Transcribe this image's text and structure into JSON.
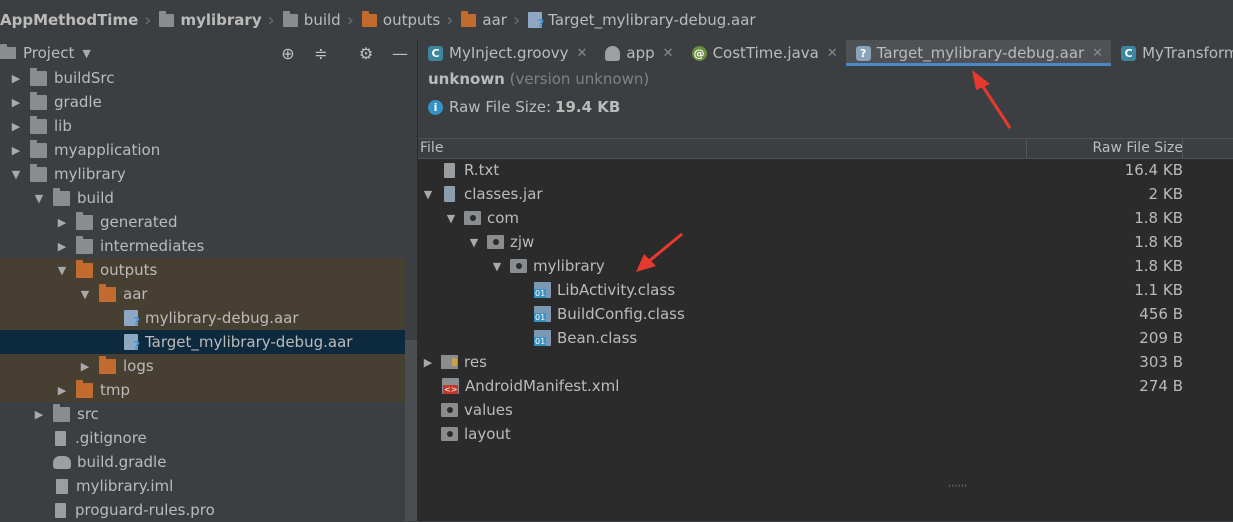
{
  "breadcrumbs": [
    "AppMethodTime",
    "mylibrary",
    "build",
    "outputs",
    "aar",
    "Target_mylibrary-debug.aar"
  ],
  "project_panel": {
    "title": "Project",
    "tree": [
      {
        "label": "buildSrc",
        "depth": 0,
        "expanded": false,
        "icon": "module-folder-icon"
      },
      {
        "label": "gradle",
        "depth": 0,
        "expanded": false,
        "icon": "folder-icon"
      },
      {
        "label": "lib",
        "depth": 0,
        "expanded": false,
        "icon": "folder-icon"
      },
      {
        "label": "myapplication",
        "depth": 0,
        "expanded": false,
        "icon": "folder-icon"
      },
      {
        "label": "mylibrary",
        "depth": 0,
        "expanded": true,
        "icon": "module-folder-icon"
      },
      {
        "label": "build",
        "depth": 1,
        "expanded": true,
        "icon": "folder-icon"
      },
      {
        "label": "generated",
        "depth": 2,
        "expanded": false,
        "icon": "folder-icon"
      },
      {
        "label": "intermediates",
        "depth": 2,
        "expanded": false,
        "icon": "folder-icon"
      },
      {
        "label": "outputs",
        "depth": 2,
        "expanded": true,
        "icon": "excluded-folder-icon"
      },
      {
        "label": "aar",
        "depth": 3,
        "expanded": true,
        "icon": "excluded-folder-icon"
      },
      {
        "label": "mylibrary-debug.aar",
        "depth": 4,
        "icon": "aar-file-icon"
      },
      {
        "label": "Target_mylibrary-debug.aar",
        "depth": 4,
        "icon": "aar-file-icon",
        "selected": true
      },
      {
        "label": "logs",
        "depth": 3,
        "expanded": false,
        "icon": "excluded-folder-icon"
      },
      {
        "label": "tmp",
        "depth": 2,
        "expanded": false,
        "icon": "excluded-folder-icon"
      },
      {
        "label": "src",
        "depth": 1,
        "expanded": false,
        "icon": "folder-icon"
      },
      {
        "label": ".gitignore",
        "depth": 1,
        "icon": "text-file-icon"
      },
      {
        "label": "build.gradle",
        "depth": 1,
        "icon": "gradle-icon"
      },
      {
        "label": "mylibrary.iml",
        "depth": 1,
        "icon": "iml-file-icon"
      },
      {
        "label": "proguard-rules.pro",
        "depth": 1,
        "icon": "text-file-icon"
      }
    ]
  },
  "tabs": [
    {
      "label": "MyInject.groovy",
      "icon": "class-icon",
      "active": false
    },
    {
      "label": "app",
      "icon": "gradle-icon",
      "active": false
    },
    {
      "label": "CostTime.java",
      "icon": "annotation-icon",
      "active": false
    },
    {
      "label": "Target_mylibrary-debug.aar",
      "icon": "aar-file-icon",
      "active": true
    },
    {
      "label": "MyTransform.groovy",
      "icon": "class-icon",
      "active": false
    }
  ],
  "aar_info": {
    "package": "unknown",
    "version": "(version unknown)",
    "raw_size_label": "Raw File Size:",
    "raw_size_value": "19.4 KB"
  },
  "table": {
    "col_file": "File",
    "col_size": "Raw File Size",
    "rows": [
      {
        "name": "R.txt",
        "size": "16.4 KB",
        "depth": 0,
        "icon": "text-file-icon"
      },
      {
        "name": "classes.jar",
        "size": "2 KB",
        "depth": 0,
        "expanded": true,
        "icon": "jar-icon"
      },
      {
        "name": "com",
        "size": "1.8 KB",
        "depth": 1,
        "expanded": true,
        "icon": "package-icon"
      },
      {
        "name": "zjw",
        "size": "1.8 KB",
        "depth": 2,
        "expanded": true,
        "icon": "package-icon"
      },
      {
        "name": "mylibrary",
        "size": "1.8 KB",
        "depth": 3,
        "expanded": true,
        "icon": "package-icon"
      },
      {
        "name": "LibActivity.class",
        "size": "1.1 KB",
        "depth": 4,
        "icon": "class-file-icon"
      },
      {
        "name": "BuildConfig.class",
        "size": "456 B",
        "depth": 4,
        "icon": "class-file-icon"
      },
      {
        "name": "Bean.class",
        "size": "209 B",
        "depth": 4,
        "icon": "class-file-icon"
      },
      {
        "name": "res",
        "size": "303 B",
        "depth": 0,
        "expanded": false,
        "icon": "res-folder-icon"
      },
      {
        "name": "AndroidManifest.xml",
        "size": "274 B",
        "depth": 0,
        "icon": "xml-file-icon"
      },
      {
        "name": "values",
        "size": "",
        "depth": 0,
        "icon": "package-icon"
      },
      {
        "name": "layout",
        "size": "",
        "depth": 0,
        "icon": "package-icon"
      }
    ]
  },
  "colors": {
    "accent": "#4a88c7",
    "selection": "#0d293e",
    "excluded": "#463f32",
    "annotation_arrow": "#e8392e"
  }
}
